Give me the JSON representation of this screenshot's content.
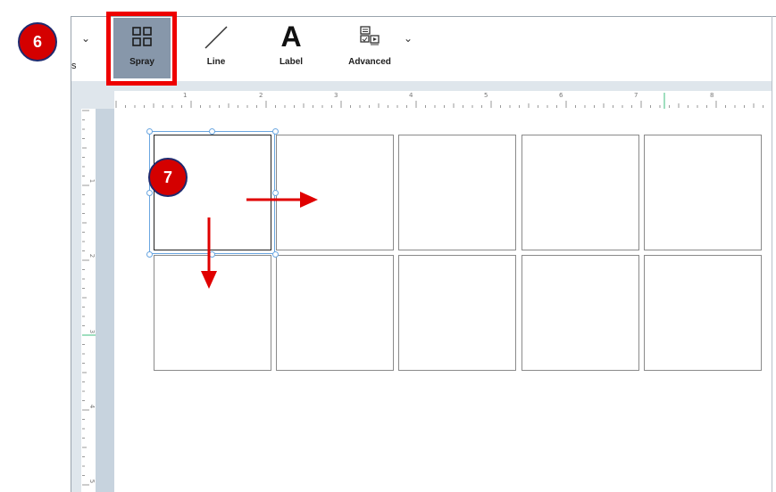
{
  "toolbar": {
    "partial_label": "s",
    "tools": {
      "spray": {
        "label": "Spray",
        "icon": "grid-icon"
      },
      "line": {
        "label": "Line",
        "icon": "line-icon"
      },
      "label": {
        "label": "Label",
        "icon": "letter-a-icon",
        "glyph": "A"
      },
      "advanced": {
        "label": "Advanced",
        "icon": "advanced-icon"
      }
    }
  },
  "ruler": {
    "horizontal": [
      "1",
      "2",
      "3",
      "4",
      "5",
      "6",
      "7",
      "8"
    ],
    "vertical": [
      "1",
      "2",
      "3",
      "4",
      "5"
    ]
  },
  "annotations": {
    "step6": "6",
    "step7": "7"
  },
  "colors": {
    "highlight": "#ee0000",
    "badge": "#d40000",
    "selection": "#6aa6e0",
    "active_tool": "#8797aa"
  }
}
